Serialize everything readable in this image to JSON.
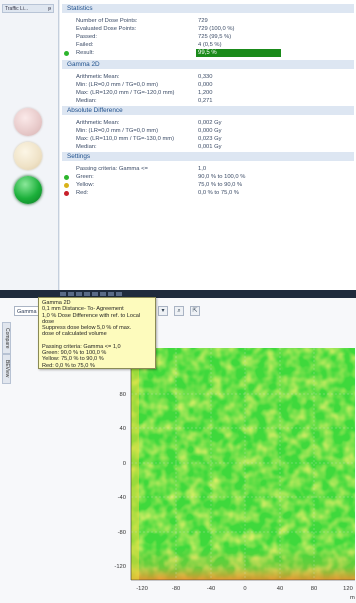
{
  "left_panel": {
    "tab_label": "Traffic Li...",
    "pin_glyph": "ᵽ",
    "lights": [
      {
        "name": "red",
        "active": false,
        "color": "#e7c9c9"
      },
      {
        "name": "yellow",
        "active": false,
        "color": "#efe2c6"
      },
      {
        "name": "green",
        "active": true,
        "color": "#1bb03a"
      }
    ]
  },
  "statistics": {
    "header": "Statistics",
    "rows": [
      {
        "label": "Number of Dose Points:",
        "value": "729"
      },
      {
        "label": "Evaluated Dose Points:",
        "value": "729 (100,0 %)"
      },
      {
        "label": "Passed:",
        "value": "725 (99,5 %)"
      },
      {
        "label": "Failed:",
        "value": "4 (0,5 %)"
      }
    ],
    "result": {
      "label": "Result:",
      "value": "99,5 %",
      "color": "#1a8a1a"
    }
  },
  "gamma2d": {
    "header": "Gamma 2D",
    "rows": [
      {
        "label": "Arithmetic Mean:",
        "value": "0,330"
      },
      {
        "label": "Min: (LR=0,0 mm / TG=0,0 mm)",
        "value": "0,000"
      },
      {
        "label": "Max: (LR=120,0 mm / TG=-120,0 mm)",
        "value": "1,200"
      },
      {
        "label": "Median:",
        "value": "0,271"
      }
    ]
  },
  "absolute_difference": {
    "header": "Absolute Difference",
    "rows": [
      {
        "label": "Arithmetic Mean:",
        "value": "0,002 Gy"
      },
      {
        "label": "Min: (LR=0,0 mm / TG=0,0 mm)",
        "value": "0,000 Gy"
      },
      {
        "label": "Max: (LR=110,0 mm / TG=-130,0 mm)",
        "value": "0,023 Gy"
      },
      {
        "label": "Median:",
        "value": "0,001 Gy"
      }
    ]
  },
  "settings": {
    "header": "Settings",
    "rows": [
      {
        "label": "Passing criteria: Gamma <=",
        "value": "1,0",
        "dot": null
      },
      {
        "label": "Green:",
        "value": "90,0 % to 100,0 %",
        "dot": "#2db52d"
      },
      {
        "label": "Yellow:",
        "value": "75,0 % to 90,0 %",
        "dot": "#d9b21a"
      },
      {
        "label": "Red:",
        "value": "0,0 % to 75,0 %",
        "dot": "#c8202a"
      }
    ]
  },
  "bottom": {
    "combo_value": "Gamma",
    "side_tabs": [
      "Compare",
      "BEView"
    ],
    "toolbar_icons": [
      "zoom-icon",
      "export-icon",
      "pan-icon"
    ]
  },
  "tooltip": {
    "lines": [
      "Gamma 2D",
      "0,1 mm Distance- To- Agreement",
      "1,0 % Dose Difference with ref. to Local",
      "dose",
      "Suppress dose below 5,0 % of max.",
      "dose of calculated volume",
      "",
      "Passing criteria: Gamma <= 1,0",
      "Green: 90,0 % to 100,0 %",
      "Yellow: 75,0 % to 90,0 %",
      "Red: 0,0 % to 75,0 %"
    ]
  },
  "gamma_map": {
    "y_ticks": [
      "80",
      "40",
      "0",
      "-40",
      "-80",
      "-120"
    ],
    "x_ticks": [
      "-120",
      "-80",
      "-40",
      "0",
      "40",
      "80",
      "120"
    ],
    "x_unit": "m",
    "colors": {
      "pass_green": "#39d93a",
      "mid_yellow": "#e8e83a",
      "warn_orange": "#f29a2a"
    }
  }
}
